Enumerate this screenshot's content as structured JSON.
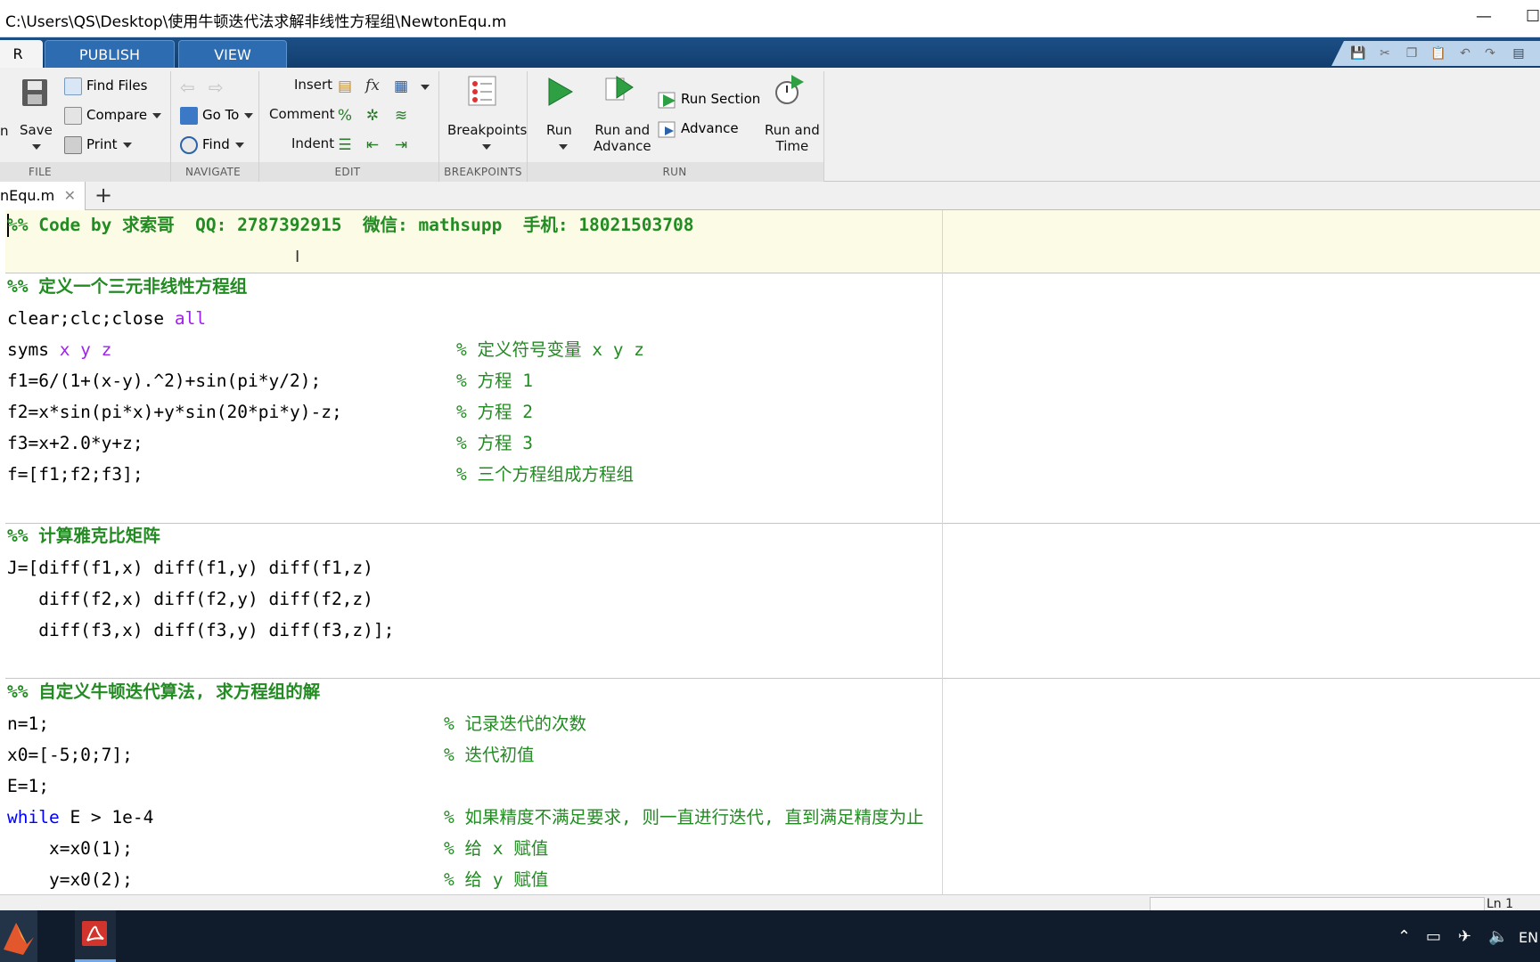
{
  "window": {
    "title": "C:\\Users\\QS\\Desktop\\使用牛顿迭代法求解非线性方程组\\NewtonEqu.m",
    "minimize_glyph": "—",
    "maximize_glyph": "☐"
  },
  "ribbon_tabs": [
    {
      "label": "R",
      "active": true
    },
    {
      "label": "PUBLISH",
      "active": false
    },
    {
      "label": "VIEW",
      "active": false
    }
  ],
  "ribbon": {
    "file": {
      "group_label": "FILE",
      "open_label_fragment": "n",
      "save_label": "Save",
      "find_files_label": "Find Files",
      "compare_label": "Compare",
      "print_label": "Print"
    },
    "navigate": {
      "group_label": "NAVIGATE",
      "goto_label": "Go To",
      "find_label": "Find"
    },
    "edit": {
      "group_label": "EDIT",
      "insert_label": "Insert",
      "comment_label": "Comment",
      "indent_label": "Indent",
      "fx_label": "fx",
      "percent_label": "%"
    },
    "breakpoints": {
      "group_label": "BREAKPOINTS",
      "breakpoints_label": "Breakpoints"
    },
    "run": {
      "group_label": "RUN",
      "run_label": "Run",
      "run_and_advance_line1": "Run and",
      "run_and_advance_line2": "Advance",
      "run_section_label": "Run Section",
      "advance_label": "Advance",
      "run_and_time_line1": "Run and",
      "run_and_time_line2": "Time"
    }
  },
  "file_tab": {
    "label": "nEqu.m",
    "close_glyph": "✕",
    "add_glyph": "+"
  },
  "code": {
    "header_section": "%% Code by 求索哥  QQ: 2787392915  微信: mathsupp  手机: 18021503708",
    "section1_title": "%% 定义一个三元非线性方程组",
    "l_clear": "clear;clc;close ",
    "l_clear_arg": "all",
    "l_syms": "syms ",
    "l_syms_args": "x y z",
    "l_f1": "f1=6/(1+(x-y).^2)+sin(pi*y/2);",
    "l_f2": "f2=x*sin(pi*x)+y*sin(20*pi*y)-z;",
    "l_f3": "f3=x+2.0*y+z;",
    "l_f": "f=[f1;f2;f3];",
    "c_syms": "% 定义符号变量 x y z",
    "c_f1": "% 方程 1",
    "c_f2": "% 方程 2",
    "c_f3": "% 方程 3",
    "c_f": "% 三个方程组成方程组",
    "section2_title": "%% 计算雅克比矩阵",
    "l_j1": "J=[diff(f1,x) diff(f1,y) diff(f1,z)",
    "l_j2": "   diff(f2,x) diff(f2,y) diff(f2,z)",
    "l_j3": "   diff(f3,x) diff(f3,y) diff(f3,z)];",
    "section3_title": "%% 自定义牛顿迭代算法, 求方程组的解",
    "l_n": "n=1;",
    "l_x0": "x0=[-5;0;7];",
    "l_e": "E=1;",
    "l_while_kw": "while",
    "l_while_rest": " E > 1e-4",
    "l_xa": "    x=x0(1);",
    "l_ya": "    y=x0(2);",
    "c_n": "% 记录迭代的次数",
    "c_x0": "% 迭代初值",
    "c_while": "% 如果精度不满足要求, 则一直进行迭代, 直到满足精度为止",
    "c_xa": "% 给 x 赋值",
    "c_ya": "% 给 y 赋值"
  },
  "status": {
    "position": "Ln 1"
  },
  "taskbar": {
    "language": "EN"
  },
  "colors": {
    "tab_strip": "#1c4f86",
    "comment_green": "#228b22",
    "keyword_blue": "#0000ff",
    "string_purple": "#a020f0",
    "cell_highlight": "#fbfbe6"
  }
}
